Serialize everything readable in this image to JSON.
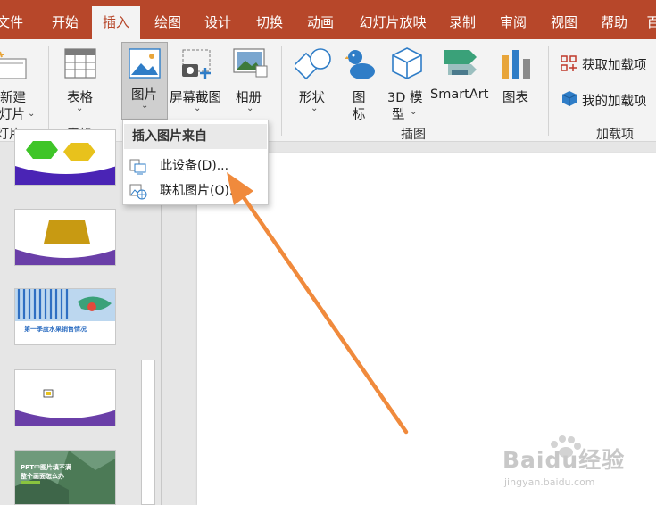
{
  "tabs": [
    {
      "label": "文件"
    },
    {
      "label": "开始"
    },
    {
      "label": "插入"
    },
    {
      "label": "绘图"
    },
    {
      "label": "设计"
    },
    {
      "label": "切换"
    },
    {
      "label": "动画"
    },
    {
      "label": "幻灯片放映"
    },
    {
      "label": "录制"
    },
    {
      "label": "审阅"
    },
    {
      "label": "视图"
    },
    {
      "label": "帮助"
    },
    {
      "label": "百"
    }
  ],
  "ribbon": {
    "new_slide": {
      "line1": "新建",
      "line2": "灯片"
    },
    "table": {
      "label": "表格"
    },
    "picture": {
      "label": "图片"
    },
    "screenshot": {
      "label": "屏幕截图"
    },
    "album": {
      "label": "相册"
    },
    "shapes": {
      "label": "形状"
    },
    "icons": {
      "line1": "图",
      "line2": "标"
    },
    "model3d": {
      "line1": "3D 模",
      "line2": "型"
    },
    "smartart": {
      "label": "SmartArt"
    },
    "chart": {
      "label": "图表"
    },
    "get_addins": {
      "label": "获取加载项"
    },
    "my_addins": {
      "label": "我的加载项"
    },
    "groups": {
      "slides": "灯片",
      "tables": "表格",
      "illustrations": "插图",
      "addins": "加载项"
    }
  },
  "dropdown": {
    "header": "插入图片来自",
    "items": [
      {
        "label": "此设备(D)..."
      },
      {
        "label": "联机图片(O)..."
      }
    ]
  },
  "thumbnails": {
    "t3_title": "第一季度水果销售情况",
    "t5_title1": "PPT中图片填不满",
    "t5_title2": "整个画面怎么办"
  },
  "watermark": {
    "text": "Baidu经验",
    "url": "jingyan.baidu.com"
  },
  "colors": {
    "accent": "#b7472a",
    "arrow": "#f08a3c",
    "thumb_purple": "#6a3fa8",
    "hexagon_green": "#3fc528",
    "hexagon_yellow": "#e8c21c",
    "trapezoid": "#c89a12"
  }
}
